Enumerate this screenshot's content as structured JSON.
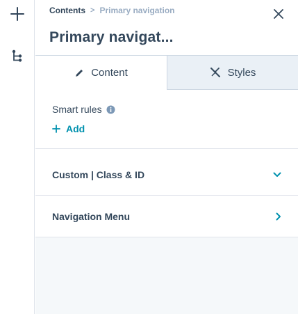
{
  "rail": {
    "items": [
      {
        "icon": "plus-icon"
      },
      {
        "icon": "tree-icon"
      }
    ]
  },
  "header": {
    "breadcrumb": {
      "link": "Contents",
      "separator": ">",
      "current": "Primary navigation"
    },
    "title": "Primary navigat...",
    "close_icon": "close-icon"
  },
  "tabs": [
    {
      "label": "Content",
      "icon": "pencil-icon",
      "active": true
    },
    {
      "label": "Styles",
      "icon": "brush-icon",
      "active": false
    }
  ],
  "smart_rules": {
    "label": "Smart rules",
    "info_icon": "info-icon",
    "add_label": "Add"
  },
  "sections": [
    {
      "label": "Custom | Class & ID",
      "chevron": "chevron-down-icon",
      "expanded": true
    },
    {
      "label": "Navigation Menu",
      "chevron": "chevron-right-icon",
      "expanded": false
    }
  ],
  "colors": {
    "accent": "#0091ae",
    "text": "#33475b",
    "muted": "#99acc2",
    "panel_bg": "#f5f8fa",
    "inactive_tab_bg": "#eaf0f6",
    "border": "#dfe3eb"
  }
}
